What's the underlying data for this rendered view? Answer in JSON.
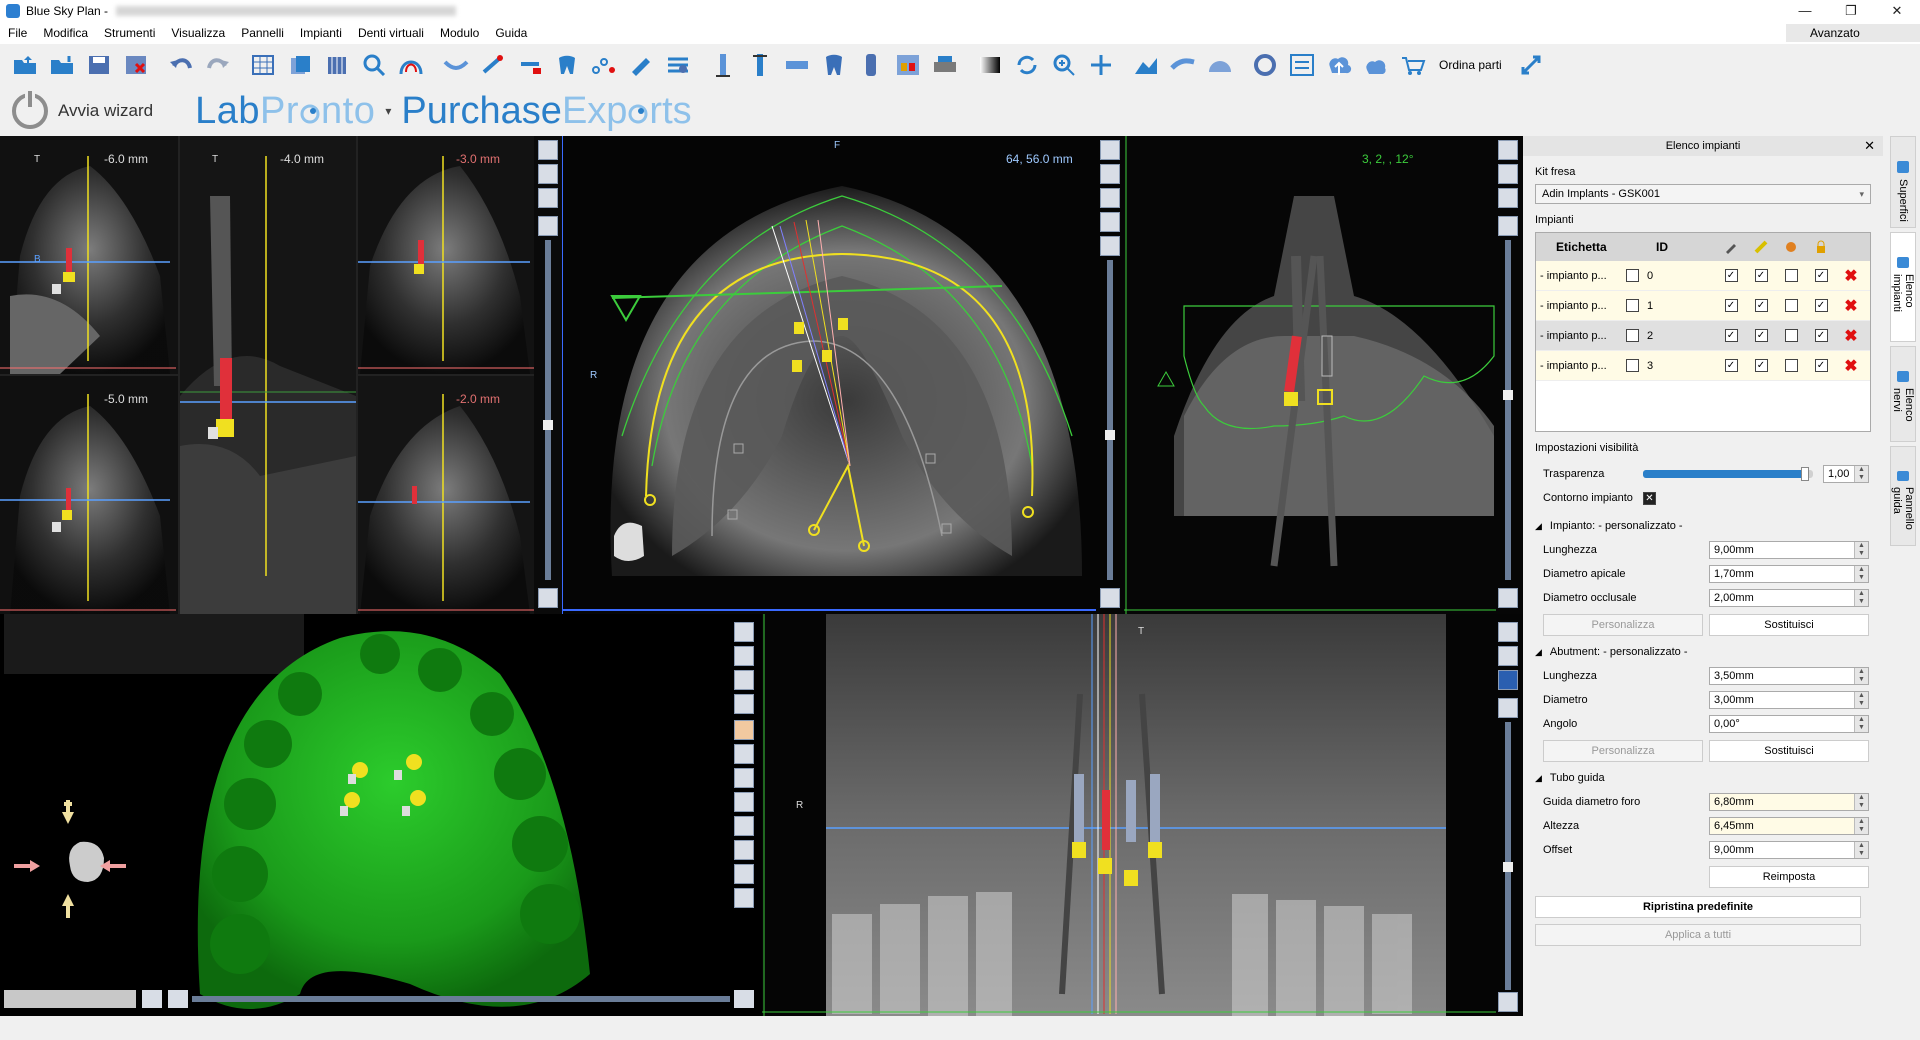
{
  "window": {
    "title": "Blue Sky Plan -",
    "minimize": "—",
    "restore": "❐",
    "close": "✕"
  },
  "menu": {
    "items": [
      "File",
      "Modifica",
      "Strumenti",
      "Visualizza",
      "Pannelli",
      "Impianti",
      "Denti virtuali",
      "Modulo",
      "Guida"
    ],
    "avanzato": "Avanzato"
  },
  "toolbar": {
    "ordina_parti": "Ordina parti"
  },
  "wizard": {
    "label": "Avvia wizard",
    "brand_lab_a": "Lab",
    "brand_lab_b": "Pr",
    "brand_lab_c": "nto",
    "brand_dropdown": "▾",
    "brand_purchase_a": "Purchase",
    "brand_purchase_b": "Exp",
    "brand_purchase_c": "rts"
  },
  "views": {
    "slice1_depth": "-6.0 mm",
    "slice2_depth": "-4.0 mm",
    "slice3_depth": "-3.0 mm",
    "slice4_depth": "-5.0 mm",
    "slice5_depth": "-2.0 mm",
    "axial_coords": "64, 56.0 mm",
    "axial_label_f": "F",
    "axial_label_r": "R",
    "coronal_coords": "3, 2, , 12°",
    "panoramic_label_t": "T",
    "panoramic_label_r": "R",
    "t_marker": "T",
    "b_marker": "B"
  },
  "panel": {
    "title": "Elenco impianti",
    "close": "✕",
    "kit_label": "Kit fresa",
    "kit_value": "Adin Implants - GSK001",
    "implants_label": "Impianti",
    "col_label": "Etichetta",
    "col_id": "ID",
    "rows": [
      {
        "label": "- impianto p...",
        "id": "0"
      },
      {
        "label": "- impianto p...",
        "id": "1"
      },
      {
        "label": "- impianto p...",
        "id": "2"
      },
      {
        "label": "- impianto p...",
        "id": "3"
      }
    ],
    "visibility_label": "Impostazioni visibilità",
    "transparency_label": "Trasparenza",
    "transparency_value": "1,00",
    "transparency_level": 0.95,
    "contour_label": "Contorno impianto",
    "implant_section": "Impianto: - personalizzato -",
    "implant_length_label": "Lunghezza",
    "implant_length": "9,00mm",
    "apical_label": "Diametro apicale",
    "apical": "1,70mm",
    "occlusal_label": "Diametro occlusale",
    "occlusal": "2,00mm",
    "customize": "Personalizza",
    "replace": "Sostituisci",
    "abutment_section": "Abutment: - personalizzato -",
    "abutment_length_label": "Lunghezza",
    "abutment_length": "3,50mm",
    "abutment_diameter_label": "Diametro",
    "abutment_diameter": "3,00mm",
    "abutment_angle_label": "Angolo",
    "abutment_angle": "0,00°",
    "tube_section": "Tubo guida",
    "hole_label": "Guida diametro foro",
    "hole": "6,80mm",
    "height_label": "Altezza",
    "height": "6,45mm",
    "offset_label": "Offset",
    "offset": "9,00mm",
    "reset": "Reimposta",
    "restore_defaults": "Ripristina predefinite",
    "apply_all": "Applica a tutti"
  },
  "side_tabs": [
    "Superfici",
    "Elenco impianti",
    "Elenco nervi",
    "Pannello guida"
  ],
  "colors": {
    "accent": "#2a7fc9",
    "accent_light": "#8ec1ea",
    "implant_red": "#e0303a",
    "guide_yellow": "#f0e020",
    "model_green": "#1faa1f"
  }
}
